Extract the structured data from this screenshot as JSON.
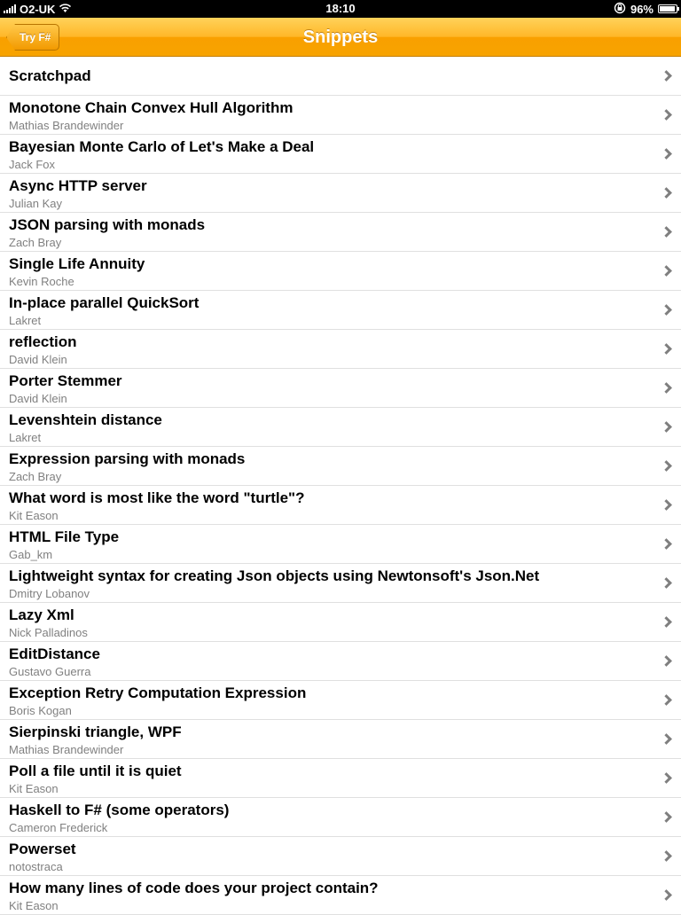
{
  "status_bar": {
    "carrier": "O2-UK",
    "time": "18:10",
    "battery": "96%",
    "battery_level": 0.96,
    "icons": [
      "signal-icon",
      "wifi-icon",
      "rotation-lock-icon",
      "battery-icon"
    ]
  },
  "nav": {
    "title": "Snippets",
    "back_label": "Try F#"
  },
  "colors": {
    "nav_accent": "#ffb728",
    "subtitle": "#808080",
    "chevron": "#7f7f7f"
  },
  "scratchpad": {
    "title": "Scratchpad"
  },
  "snippets": [
    {
      "title": "Monotone Chain Convex Hull Algorithm",
      "author": "Mathias Brandewinder"
    },
    {
      "title": "Bayesian Monte Carlo of Let's Make a Deal",
      "author": "Jack Fox"
    },
    {
      "title": "Async HTTP server",
      "author": "Julian Kay"
    },
    {
      "title": "JSON parsing with monads",
      "author": "Zach Bray"
    },
    {
      "title": "Single Life Annuity",
      "author": "Kevin Roche"
    },
    {
      "title": "In-place parallel QuickSort",
      "author": "Lakret"
    },
    {
      "title": "reflection",
      "author": "David Klein"
    },
    {
      "title": "Porter Stemmer",
      "author": "David Klein"
    },
    {
      "title": "Levenshtein distance",
      "author": "Lakret"
    },
    {
      "title": "Expression parsing with monads",
      "author": "Zach Bray"
    },
    {
      "title": "What word is most like the word \"turtle\"?",
      "author": "Kit Eason"
    },
    {
      "title": "HTML File Type",
      "author": "Gab_km"
    },
    {
      "title": "Lightweight syntax for creating Json objects using Newtonsoft's Json.Net",
      "author": "Dmitry Lobanov"
    },
    {
      "title": "Lazy Xml",
      "author": "Nick Palladinos"
    },
    {
      "title": "EditDistance",
      "author": "Gustavo Guerra"
    },
    {
      "title": "Exception Retry Computation Expression",
      "author": "Boris Kogan"
    },
    {
      "title": "Sierpinski triangle, WPF",
      "author": "Mathias Brandewinder"
    },
    {
      "title": "Poll a file until it is quiet",
      "author": "Kit Eason"
    },
    {
      "title": "Haskell to F# (some operators)",
      "author": "Cameron Frederick"
    },
    {
      "title": "Powerset",
      "author": "notostraca"
    },
    {
      "title": "How many lines of code does your project contain?",
      "author": "Kit Eason"
    }
  ]
}
